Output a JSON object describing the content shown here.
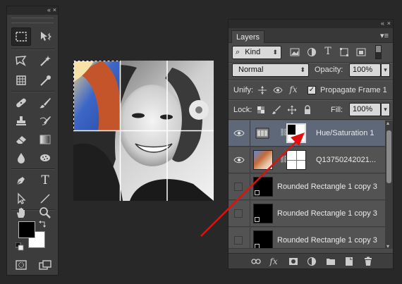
{
  "tools_panel": {
    "collapse_glyph": "«",
    "close_glyph": "×",
    "tools": [
      {
        "name": "rectangular-marquee-tool",
        "icon": "marquee-icon",
        "active": true
      },
      {
        "name": "move-tool",
        "icon": "move-icon"
      },
      {
        "name": "lasso-tool",
        "icon": "lasso-icon"
      },
      {
        "name": "magic-wand-tool",
        "icon": "magic-wand-icon"
      },
      {
        "name": "crop-tool",
        "icon": "crop-icon"
      },
      {
        "name": "eyedropper-tool",
        "icon": "eyedropper-icon"
      },
      {
        "name": "healing-brush-tool",
        "icon": "bandage-icon"
      },
      {
        "name": "brush-tool",
        "icon": "brush-icon"
      },
      {
        "name": "clone-stamp-tool",
        "icon": "stamp-icon"
      },
      {
        "name": "history-brush-tool",
        "icon": "history-brush-icon"
      },
      {
        "name": "eraser-tool",
        "icon": "eraser-icon"
      },
      {
        "name": "gradient-tool",
        "icon": "gradient-icon"
      },
      {
        "name": "blur-tool",
        "icon": "drop-icon"
      },
      {
        "name": "dodge-tool",
        "icon": "sponge-icon"
      },
      {
        "name": "pen-tool",
        "icon": "pen-icon"
      },
      {
        "name": "type-tool",
        "icon": "type-icon"
      },
      {
        "name": "path-selection-tool",
        "icon": "arrow-icon"
      },
      {
        "name": "line-tool",
        "icon": "line-icon"
      },
      {
        "name": "hand-tool",
        "icon": "hand-icon"
      },
      {
        "name": "zoom-tool",
        "icon": "zoom-icon"
      }
    ],
    "type_glyph": "T",
    "foreground_color": "#000000",
    "background_color": "#ffffff"
  },
  "layers_panel": {
    "collapse_glyph": "«",
    "close_glyph": "×",
    "tab_label": "Layers",
    "menu_glyph": "▾≡",
    "filter": {
      "search_glyph": "⌕",
      "kind_label": "Kind",
      "arrows": "⬍"
    },
    "filter_type_glyph": "T",
    "blend_mode": "Normal",
    "blend_arrows": "⬍",
    "opacity_label": "Opacity:",
    "opacity_value": "100%",
    "unify_label": "Unify:",
    "propagate_checked": "✓",
    "propagate_label": "Propagate Frame 1",
    "lock_label": "Lock:",
    "fill_label": "Fill:",
    "fill_value": "100%",
    "dropdown_arrow": "▾",
    "chain_glyph": "⛓",
    "layers": [
      {
        "name": "Hue/Saturation 1",
        "visible": true,
        "selected": true
      },
      {
        "name": "Q13750242021...",
        "visible": true,
        "selected": false
      },
      {
        "name": "Rounded Rectangle 1 copy 3",
        "visible": false,
        "selected": false
      },
      {
        "name": "Rounded Rectangle 1 copy 3",
        "visible": false,
        "selected": false
      },
      {
        "name": "Rounded Rectangle 1 copy 3",
        "visible": false,
        "selected": false
      }
    ],
    "scroll_up": "▴",
    "scroll_down": "▾",
    "bottom_actions": [
      "link-layers-icon",
      "fx-icon",
      "add-mask-icon",
      "adjustment-layer-icon",
      "new-group-icon",
      "new-layer-icon",
      "trash-icon"
    ],
    "fx_label": "fx"
  },
  "annotation": {
    "arrow_color": "#e01010"
  }
}
